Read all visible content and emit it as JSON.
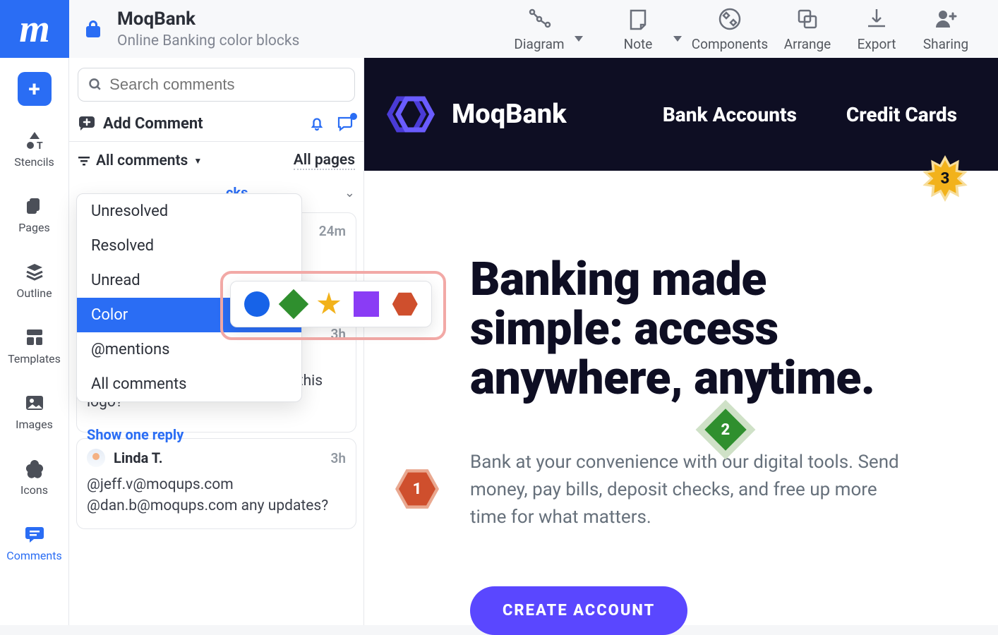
{
  "app": {
    "title": "MoqBank",
    "subtitle": "Online Banking color blocks"
  },
  "top_actions": {
    "diagram": "Diagram",
    "note": "Note",
    "components": "Components",
    "arrange": "Arrange",
    "export": "Export",
    "sharing": "Sharing"
  },
  "leftbar": {
    "stencils": "Stencils",
    "pages": "Pages",
    "outline": "Outline",
    "templates": "Templates",
    "images": "Images",
    "icons": "Icons",
    "comments": "Comments"
  },
  "comments_panel": {
    "search_placeholder": "Search comments",
    "add_comment": "Add Comment",
    "filter_label": "All comments",
    "filter_scope": "All pages",
    "visible_page_tag_fragment": "cks",
    "dropdown": {
      "unresolved": "Unresolved",
      "resolved": "Resolved",
      "unread": "Unread",
      "color": "Color",
      "mentions": "@mentions",
      "all": "All comments"
    },
    "comments": [
      {
        "author": "",
        "time": "24m",
        "text_visible": "",
        "show_reply": ""
      },
      {
        "author": "",
        "time": "3h",
        "text": "Can we try a different colour for this logo?",
        "show_reply": "Show one reply"
      },
      {
        "author": "Linda T.",
        "time": "3h",
        "text": "@jeff.v@moqups.com @dan.b@moqups.com any updates?"
      }
    ]
  },
  "canvas": {
    "brand": "MoqBank",
    "nav": {
      "accounts": "Bank Accounts",
      "cards": "Credit Cards"
    },
    "hero_title": "Banking made simple: access anywhere, anytime.",
    "hero_body": "Bank at your convenience with our digital tools. Send money, pay bills, deposit checks, and free up more time for what matters.",
    "cta": "CREATE ACCOUNT",
    "markers": {
      "m1": "1",
      "m2": "2",
      "m3": "3"
    }
  }
}
